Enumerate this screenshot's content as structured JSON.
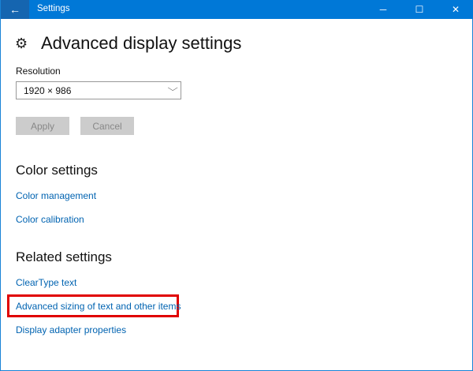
{
  "titlebar": {
    "title": "Settings",
    "back_icon": "←",
    "min_icon": "─",
    "max_icon": "☐",
    "close_icon": "✕"
  },
  "page": {
    "title": "Advanced display settings",
    "gear_icon": "⚙"
  },
  "resolution": {
    "label": "Resolution",
    "value": "1920 × 986",
    "chevron": "⌵"
  },
  "buttons": {
    "apply": "Apply",
    "cancel": "Cancel"
  },
  "color_settings": {
    "heading": "Color settings",
    "links": [
      "Color management",
      "Color calibration"
    ]
  },
  "related_settings": {
    "heading": "Related settings",
    "links": [
      "ClearType text",
      "Advanced sizing of text and other items",
      "Display adapter properties"
    ]
  },
  "highlight_color": "#e00000",
  "accent": "#0078d7"
}
